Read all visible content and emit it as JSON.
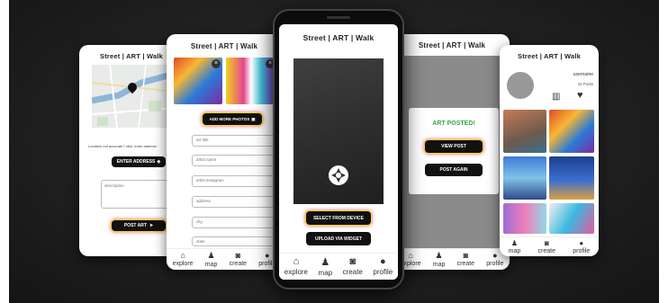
{
  "app_title": "Street | ART | Walk",
  "nav": {
    "explore": "explore",
    "map": "map",
    "create": "create",
    "profile": "profile"
  },
  "map_screen": {
    "location_prompt": "Location not accurate? click 'enter address'",
    "enter_address": "ENTER ADDRESS",
    "description_placeholder": "description",
    "post_art": "POST ART"
  },
  "form_screen": {
    "add_more_photos": "ADD MORE PHOTOS",
    "fields": [
      "art title",
      "artist name",
      "artist instagram",
      "address",
      "city",
      "state"
    ]
  },
  "camera_screen": {
    "select_from_device": "SELECT FROM DEVICE",
    "upload_via_widget": "UPLOAD VIA WIDGET"
  },
  "posted_screen": {
    "message": "ART POSTED!",
    "view_post": "VIEW POST",
    "post_again": "POST AGAIN"
  },
  "profile_screen": {
    "username": "username",
    "posts": "42 Posts"
  },
  "colors": {
    "accent_green": "#3aa845",
    "glow_yellow": "#f4d03f",
    "glow_pink": "#e056a0"
  }
}
